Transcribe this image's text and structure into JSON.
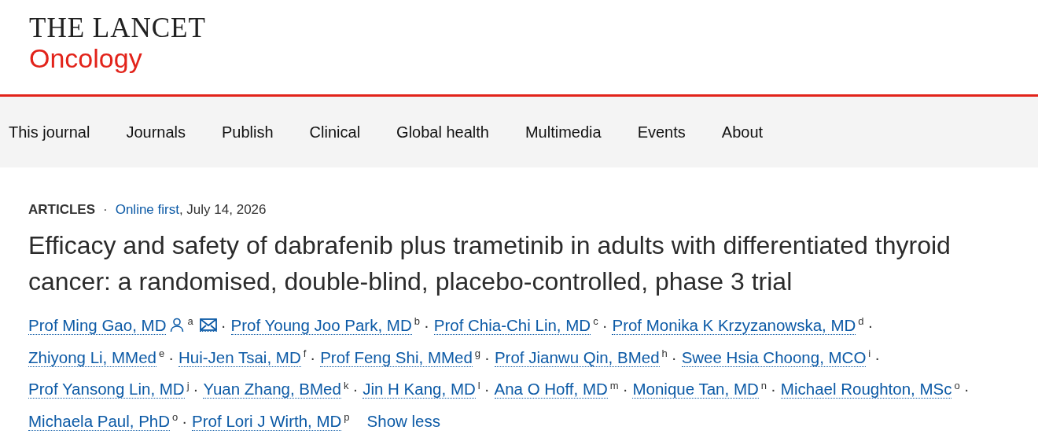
{
  "logo": {
    "title": "THE LANCET",
    "subtitle": "Oncology"
  },
  "nav": [
    {
      "label": "This journal"
    },
    {
      "label": "Journals"
    },
    {
      "label": "Publish"
    },
    {
      "label": "Clinical"
    },
    {
      "label": "Global health"
    },
    {
      "label": "Multimedia"
    },
    {
      "label": "Events"
    },
    {
      "label": "About"
    }
  ],
  "meta": {
    "section": "ARTICLES",
    "separator": "·",
    "link": "Online first",
    "date": ", July 14, 2026"
  },
  "title": "Efficacy and safety of dabrafenib plus trametinib in adults with differentiated thyroid cancer: a randomised, double-blind, placebo-controlled, phase 3 trial",
  "authors": [
    {
      "name": "Prof Ming Gao, MD",
      "affiliation": "a",
      "corresponding": true,
      "separator": "·"
    },
    {
      "name": "Prof Young Joo Park, MD",
      "affiliation": "b",
      "corresponding": false,
      "separator": "·"
    },
    {
      "name": "Prof Chia-Chi Lin, MD",
      "affiliation": "c",
      "corresponding": false,
      "separator": "·"
    },
    {
      "name": "Prof Monika K Krzyzanowska, MD",
      "affiliation": "d",
      "corresponding": false,
      "separator": "·"
    },
    {
      "name": "Zhiyong Li, MMed",
      "affiliation": "e",
      "corresponding": false,
      "separator": "·"
    },
    {
      "name": "Hui-Jen Tsai, MD",
      "affiliation": "f",
      "corresponding": false,
      "separator": "·"
    },
    {
      "name": "Prof Feng Shi, MMed",
      "affiliation": "g",
      "corresponding": false,
      "separator": "·"
    },
    {
      "name": "Prof Jianwu Qin, BMed",
      "affiliation": "h",
      "corresponding": false,
      "separator": "·"
    },
    {
      "name": "Swee Hsia Choong, MCO",
      "affiliation": "i",
      "corresponding": false,
      "separator": "·"
    },
    {
      "name": "Prof Yansong Lin, MD",
      "affiliation": "j",
      "corresponding": false,
      "separator": "·"
    },
    {
      "name": "Yuan Zhang, BMed",
      "affiliation": "k",
      "corresponding": false,
      "separator": "·"
    },
    {
      "name": "Jin H Kang, MD",
      "affiliation": "l",
      "corresponding": false,
      "separator": "·"
    },
    {
      "name": "Ana O Hoff, MD",
      "affiliation": "m",
      "corresponding": false,
      "separator": "·"
    },
    {
      "name": "Monique Tan, MD",
      "affiliation": "n",
      "corresponding": false,
      "separator": "·"
    },
    {
      "name": "Michael Roughton, MSc",
      "affiliation": "o",
      "corresponding": false,
      "separator": "·"
    },
    {
      "name": "Michaela Paul, PhD",
      "affiliation": "o",
      "corresponding": false,
      "separator": "·"
    },
    {
      "name": "Prof Lori J Wirth, MD",
      "affiliation": "p",
      "corresponding": false
    }
  ],
  "show_less": "Show less"
}
